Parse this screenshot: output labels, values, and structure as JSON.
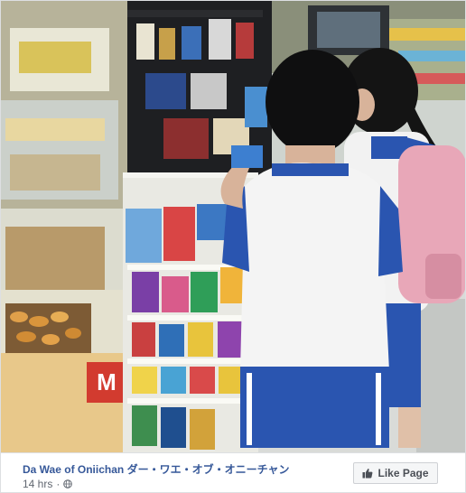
{
  "post": {
    "page_name": "Da Wae of Oniichan ダー・ワエ・オブ・オニーチャン",
    "timestamp": "14 hrs",
    "separator": "·",
    "audience_icon": "globe-icon",
    "like_button_label": "Like Page",
    "like_icon": "thumbs-up-icon"
  },
  "photo": {
    "store_sign": "M"
  },
  "colors": {
    "link": "#365899",
    "meta": "#616770",
    "button_bg": "#f5f6f7",
    "button_border": "#ced0d4"
  }
}
